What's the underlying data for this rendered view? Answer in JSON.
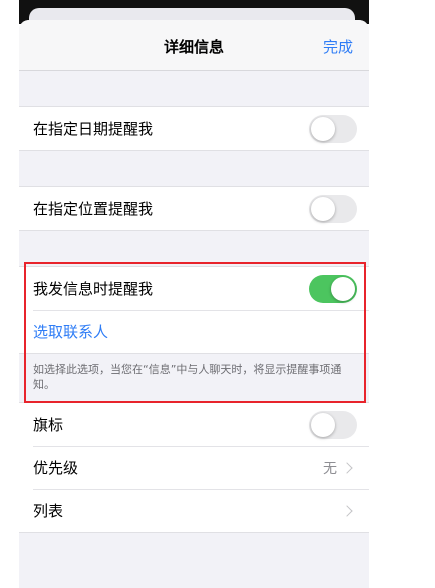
{
  "header": {
    "title": "详细信息",
    "done_label": "完成"
  },
  "date_reminder": {
    "label": "在指定日期提醒我",
    "on": false
  },
  "location_reminder": {
    "label": "在指定位置提醒我",
    "on": false
  },
  "messaging_reminder": {
    "label": "我发信息时提醒我",
    "on": true,
    "choose_contact": "选取联系人",
    "footer": "如选择此选项，当您在“信息”中与人聊天时，将显示提醒事项通知。"
  },
  "flag": {
    "label": "旗标",
    "on": false
  },
  "priority": {
    "label": "优先级",
    "value": "无"
  },
  "list": {
    "label": "列表"
  },
  "colors": {
    "accent": "#2f7df6",
    "toggle_on": "#4cc55f",
    "highlight": "#e8242c"
  }
}
